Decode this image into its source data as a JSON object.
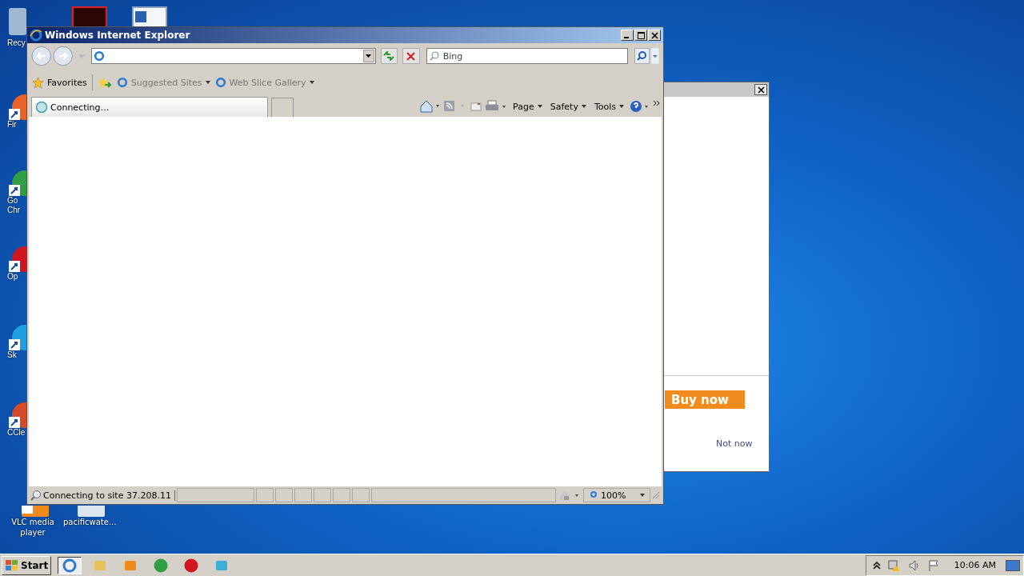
{
  "desktop": {
    "side_icons": [
      {
        "kind": "bin",
        "label": "Recy"
      },
      {
        "kind": "fox",
        "label": "Fir"
      },
      {
        "kind": "chrome",
        "label": "Go Chr"
      },
      {
        "kind": "opera",
        "label": "Op"
      },
      {
        "kind": "skype",
        "label": "Sk"
      },
      {
        "kind": "ccleaner",
        "label": "CCle"
      }
    ],
    "top_icons": [
      {
        "kind": "acrobat"
      },
      {
        "kind": "word"
      }
    ],
    "bottom_icons": [
      {
        "kind": "vlc",
        "label": "VLC media player"
      },
      {
        "kind": "file",
        "label": "pacificwate..."
      }
    ]
  },
  "popup": {
    "buy_button": "Buy now",
    "not_now_link": "Not now"
  },
  "browser": {
    "title": "Windows Internet Explorer",
    "search": {
      "placeholder": "Bing"
    },
    "favorites": [
      {
        "kind": "star",
        "label": "Favorites"
      },
      {
        "kind": "ie",
        "label": "Suggested Sites"
      },
      {
        "kind": "ie",
        "label": "Web Slice Gallery"
      }
    ],
    "tab": {
      "label": "Connecting…"
    },
    "commands": [
      "Page",
      "Safety",
      "Tools"
    ],
    "status": "Connecting to site 37.208.11",
    "zoom": "100%"
  },
  "taskbar": {
    "start": "Start",
    "apps": [
      {
        "kind": "ie",
        "selected": true
      },
      {
        "kind": "folder",
        "selected": false
      },
      {
        "kind": "media",
        "selected": false
      },
      {
        "kind": "chrome",
        "selected": false
      },
      {
        "kind": "opera",
        "selected": false
      },
      {
        "kind": "lock",
        "selected": false
      }
    ],
    "clock": "10:06 AM"
  }
}
